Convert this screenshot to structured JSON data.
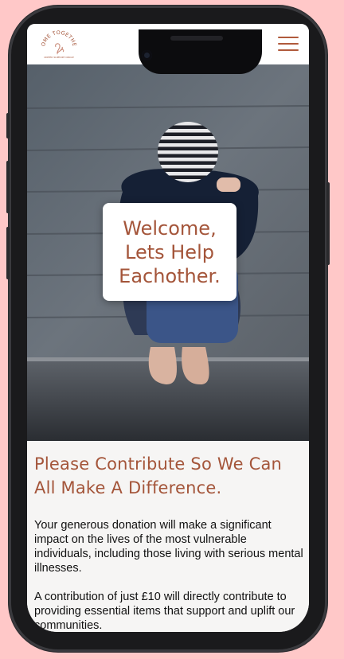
{
  "header": {
    "logo_top_text": "COME TOGETHER",
    "logo_bottom_text": "UNITED SUPPORT CIRCLE",
    "menu_icon": "hamburger-menu-icon"
  },
  "hero": {
    "welcome_text": "Welcome,\nLets Help\nEachother."
  },
  "content": {
    "headline": "Please Contribute So We Can All Make A Difference.",
    "paragraph_1": "Your generous donation will make a significant impact on the lives of the most vulnerable individuals, including those living with serious mental illnesses.",
    "paragraph_2": "A contribution of just £10 will directly contribute to providing essential items that support and uplift our communities."
  },
  "colors": {
    "accent": "#a4553a",
    "background": "#ffc8c8",
    "content_background": "#f6f5f4"
  }
}
